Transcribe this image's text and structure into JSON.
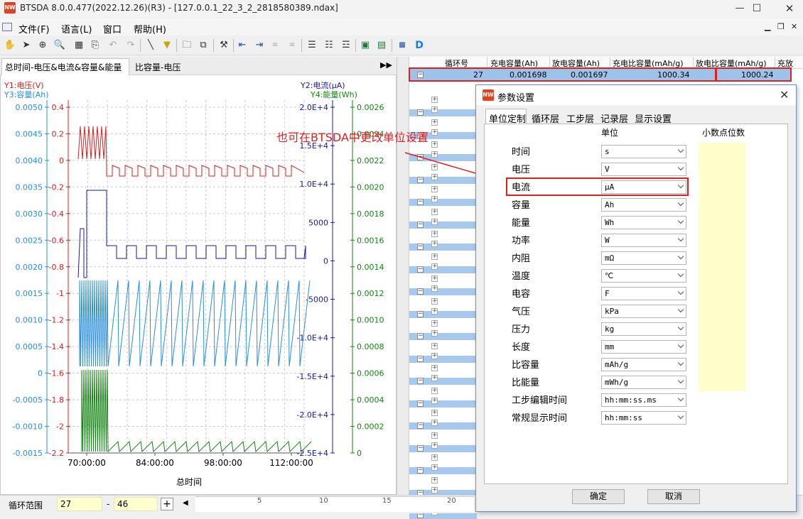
{
  "window": {
    "title": "BTSDA 8.0.0.477(2022.12.26)(R3) - [127.0.0.1_22_3_2_2818580389.ndax]",
    "icon": "app-logo-icon",
    "app_icon_text": "NW"
  },
  "menu": [
    "文件(F)",
    "语言(L)",
    "窗口",
    "帮助(H)"
  ],
  "chart": {
    "tabs": [
      "总时间-电压&电流&容量&能量",
      "比容量-电压"
    ],
    "y1_label": "Y1:电压(V)",
    "y2_label": "Y2:电流(μA)",
    "y3_label": "Y3:容量(Ah)",
    "y4_label": "Y4:能量(Wh)",
    "x_label": "总时间",
    "colors": {
      "voltage": "#d42020",
      "current": "#1a1aa0",
      "capacity": "#2a8fd8",
      "energy": "#138513"
    }
  },
  "chart_data": {
    "type": "line",
    "xlabel": "总时间",
    "x_ticks": [
      "70:00:00",
      "84:00:00",
      "98:00:00",
      "112:00:00"
    ],
    "y1": {
      "label": "电压(V)",
      "ticks": [
        "0.4",
        "0.2",
        "0",
        "-0.2",
        "-0.4",
        "-0.6",
        "-0.8",
        "-1",
        "-1.2",
        "-1.4",
        "-1.6",
        "-1.8",
        "-2",
        "-2.2"
      ]
    },
    "y2": {
      "label": "电流(μA)",
      "ticks": [
        "2.0E+4",
        "1.5E+4",
        "1.0E+4",
        "5000",
        "0",
        "-5000",
        "-1.0E+4",
        "-1.5E+4",
        "-2.0E+4",
        "-2.5E+4"
      ]
    },
    "y3": {
      "label": "容量(Ah)",
      "ticks": [
        "0.0050",
        "0.0045",
        "0.0040",
        "0.0035",
        "0.0030",
        "0.0025",
        "0.0020",
        "0.0015",
        "0.0010",
        "0.0005",
        "0",
        "-0.0005",
        "-0.0010",
        "-0.0015"
      ]
    },
    "y4": {
      "label": "能量(Wh)",
      "ticks": [
        "0.0026",
        "0.0024",
        "0.0022",
        "0.0020",
        "0.0018",
        "0.0016",
        "0.0014",
        "0.0012",
        "0.0010",
        "0.0008",
        "0.0006",
        "0.0004",
        "0.0002",
        "0"
      ]
    },
    "grid": true
  },
  "grid": {
    "columns": [
      "循环号",
      "充电容量(Ah)",
      "放电容量(Ah)",
      "充电比容量(mAh/g)",
      "放电比容量(mAh/g)",
      "充放"
    ],
    "selected_row": [
      "27",
      "0.001698",
      "0.001697",
      "1000.34",
      "1000.24"
    ]
  },
  "annotation": "也可在BTSDA中更改单位设置",
  "dialog": {
    "title": "参数设置",
    "tabs": [
      "单位定制",
      "循环层",
      "工步层",
      "记录层",
      "显示设置"
    ],
    "col_unit": "单位",
    "col_decimals": "小数点位数",
    "rows": [
      {
        "label": "时间",
        "unit": "s"
      },
      {
        "label": "电压",
        "unit": "V"
      },
      {
        "label": "电流",
        "unit": "μA"
      },
      {
        "label": "容量",
        "unit": "Ah"
      },
      {
        "label": "能量",
        "unit": "Wh"
      },
      {
        "label": "功率",
        "unit": "W"
      },
      {
        "label": "内阻",
        "unit": "mΩ"
      },
      {
        "label": "温度",
        "unit": "℃"
      },
      {
        "label": "电容",
        "unit": "F"
      },
      {
        "label": "气压",
        "unit": "kPa"
      },
      {
        "label": "压力",
        "unit": "kg"
      },
      {
        "label": "长度",
        "unit": "mm"
      },
      {
        "label": "比容量",
        "unit": "mAh/g"
      },
      {
        "label": "比能量",
        "unit": "mWh/g"
      },
      {
        "label": "工步编辑时间",
        "unit": "hh:mm:ss.ms"
      },
      {
        "label": "常规显示时间",
        "unit": "hh:mm:ss"
      }
    ],
    "ok": "确定",
    "cancel": "取消"
  },
  "bottom": {
    "label": "循环范围",
    "from": "27",
    "to": "46",
    "ruler": [
      "5",
      "10",
      "15",
      "20"
    ]
  }
}
